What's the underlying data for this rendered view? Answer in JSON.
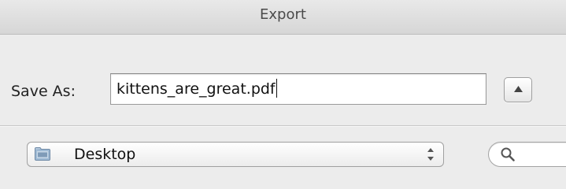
{
  "window": {
    "title": "Export"
  },
  "save": {
    "label": "Save As:",
    "filename": "kittens_are_great.pdf"
  },
  "location": {
    "selected": "Desktop"
  },
  "icons": {
    "disclosure": "chevron-up-icon",
    "folder": "folder-icon",
    "updown": "updown-arrows-icon",
    "search": "search-icon"
  }
}
